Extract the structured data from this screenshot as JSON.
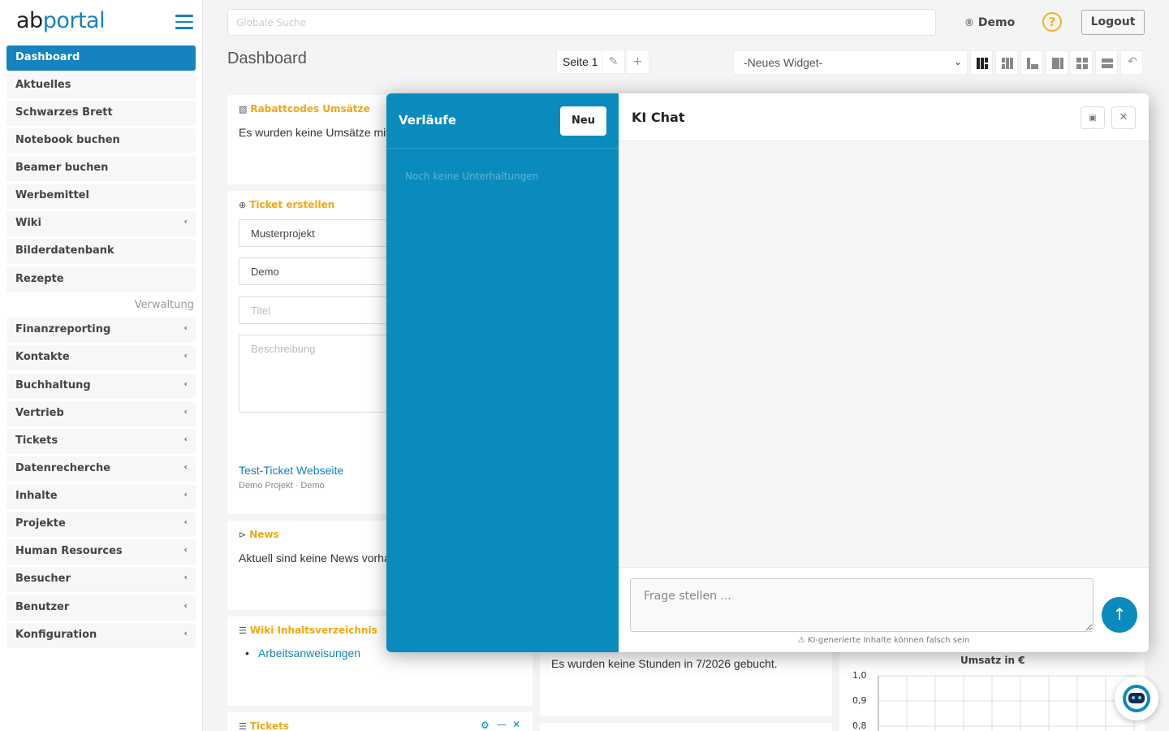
{
  "brand": {
    "part1": "ab",
    "part2": "portal"
  },
  "sidebar": {
    "items": [
      {
        "label": "Dashboard"
      },
      {
        "label": "Aktuelles"
      },
      {
        "label": "Schwarzes Brett"
      },
      {
        "label": "Notebook buchen"
      },
      {
        "label": "Beamer buchen"
      },
      {
        "label": "Werbemittel"
      },
      {
        "label": "Wiki"
      },
      {
        "label": "Bilderdatenbank"
      },
      {
        "label": "Rezepte"
      }
    ],
    "section": "Verwaltung",
    "admin_items": [
      {
        "label": "Finanzreporting"
      },
      {
        "label": "Kontakte"
      },
      {
        "label": "Buchhaltung"
      },
      {
        "label": "Vertrieb"
      },
      {
        "label": "Tickets"
      },
      {
        "label": "Datenrecherche"
      },
      {
        "label": "Inhalte"
      },
      {
        "label": "Projekte"
      },
      {
        "label": "Human Resources"
      },
      {
        "label": "Besucher"
      },
      {
        "label": "Benutzer"
      },
      {
        "label": "Konfiguration"
      }
    ],
    "chevron": "‹"
  },
  "topbar": {
    "search_placeholder": "Globale Suche",
    "user": "Demo",
    "help": "?",
    "logout": "Logout"
  },
  "dashboard": {
    "title": "Dashboard",
    "page_tab": "Seite 1",
    "widget_select": "-Neues Widget-"
  },
  "widgets": {
    "rabatt": {
      "title": "Rabattcodes Umsätze",
      "text": "Es wurden keine Umsätze mit"
    },
    "ticket": {
      "title": "Ticket erstellen",
      "project": "Musterprojekt",
      "user": "Demo",
      "title_placeholder": "Titel",
      "desc_placeholder": "Beschreibung",
      "recent_link": "Test-Ticket Webseite",
      "recent_meta": "Demo Projekt · Demo"
    },
    "news": {
      "title": "News",
      "text": "Aktuell sind keine News vorha"
    },
    "wiki": {
      "title": "Wiki Inhaltsverzeichnis",
      "item": "Arbeitsanweisungen"
    },
    "tickets": {
      "title": "Tickets"
    },
    "hours": {
      "text": "Es wurden keine Stunden in 7/2026 gebucht."
    }
  },
  "chart_data": {
    "type": "line",
    "title": "Umsatz in €",
    "yticks": [
      "1,0",
      "0,9",
      "0,8"
    ]
  },
  "modal": {
    "history_title": "Verläufe",
    "new_button": "Neu",
    "history_empty": "Noch keine Unterhaltungen",
    "chat_title": "KI Chat",
    "input_placeholder": "Frage stellen ...",
    "disclaimer": "⚠ KI-generierte Inhalte können falsch sein"
  },
  "colors": {
    "brand": "#1483be",
    "accent": "#f3a712",
    "modal_sidebar": "#0a8bbd"
  }
}
